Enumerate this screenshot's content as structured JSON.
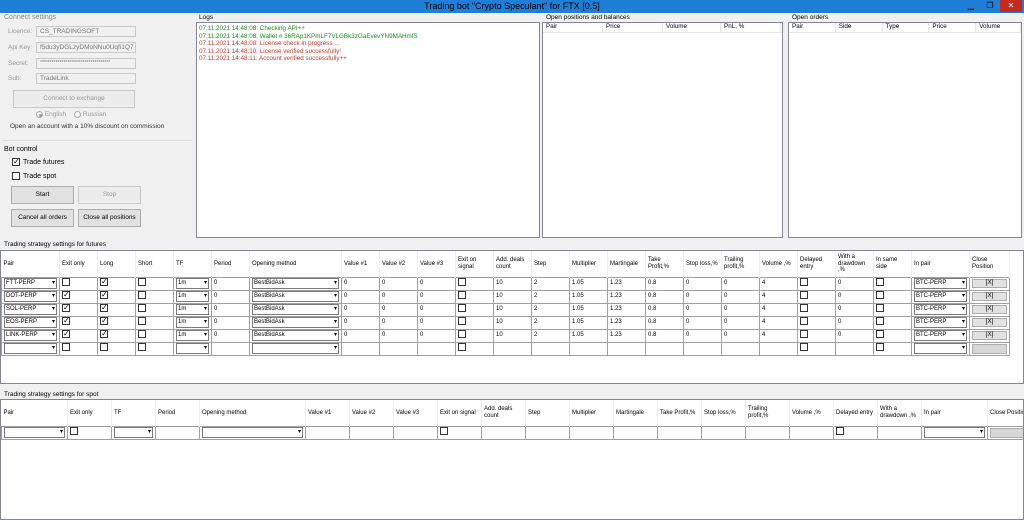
{
  "window": {
    "title": "Trading bot \"Crypto Speculant\" for FTX [0.5]",
    "minimize": "▁",
    "restore": "❐",
    "close": "✕"
  },
  "connect": {
    "group_title": "Connect settings",
    "licence_label": "Licence:",
    "licence_value": "CS_TRADINGSOFT",
    "apikey_label": "Api Key:",
    "apikey_value": "f5du3yDGLzyDMoNNu0Uqfi1Q7",
    "secret_label": "Secret:",
    "secret_value": "************************************",
    "sub_label": "Sub:",
    "sub_value": "TradeLink",
    "connect_button": "Connect to exchange",
    "lang_english": "English",
    "lang_russian": "Russian",
    "promo_text": "Open an account with a 10% discount on commission"
  },
  "bot_control": {
    "group_title": "Bot control",
    "trade_futures": "Trade futures",
    "trade_futures_checked": true,
    "trade_spot": "Trade spot",
    "trade_spot_checked": false,
    "start": "Start",
    "stop": "Stop",
    "cancel_all": "Cancel all orders",
    "close_all": "Close all positions"
  },
  "logs": {
    "title": "Logs",
    "lines": [
      {
        "text": "07.11.2021 14:48:08: Checking API++",
        "color": "#1a8a1a"
      },
      {
        "text": "07.11.2021 14:48:08: Wallet # 36RAp1KPmLF7VLGBk3zGaEvevYN9MAHmfS",
        "color": "#1a8a1a"
      },
      {
        "text": "07.11.2021 14:48:08: License check in progress ...",
        "color": "#c0392b"
      },
      {
        "text": "07.11.2021 14:48:10: License verified successfully!",
        "color": "#c0392b"
      },
      {
        "text": "07.11.2021 14:48:11: Account verified successfully++",
        "color": "#c0392b"
      }
    ]
  },
  "positions": {
    "title": "Open positions and balances",
    "columns": [
      "Pair",
      "Price",
      "Volume",
      "PnL, %"
    ]
  },
  "orders": {
    "title": "Open orders",
    "columns": [
      "Pair",
      "Side",
      "Type",
      "Price",
      "Volume"
    ]
  },
  "futures": {
    "title": "Trading strategy settings for futures",
    "columns": [
      "Pair",
      "Exit only",
      "Long",
      "Short",
      "TF",
      "Period",
      "Opening method",
      "Value #1",
      "Value #2",
      "Value #3",
      "Exit on signal",
      "Add. deals count",
      "Step",
      "Multiplier",
      "Martingale",
      "Take Profit,%",
      "Stop loss,%",
      "Trailing profit,%",
      "Volume ,%",
      "Delayed entry",
      "With a drawdown ,%",
      "In same side",
      "In pair",
      "Close Position"
    ],
    "rows": [
      {
        "pair": "FTT-PERP",
        "exit_only": false,
        "long": true,
        "short": false,
        "tf": "1m",
        "period": "0",
        "method": "BestBidAsk",
        "v1": "0",
        "v2": "0",
        "v3": "0",
        "exit_signal": false,
        "add_deals": "10",
        "step": "2",
        "mult": "1.05",
        "mart": "1.23",
        "tp": "0.8",
        "sl": "0",
        "trail": "0",
        "volume": "4",
        "delayed": false,
        "drawdown": "0",
        "same_side": false,
        "in_pair": "BTC-PERP",
        "close": "[X]"
      },
      {
        "pair": "DOT-PERP",
        "exit_only": true,
        "long": true,
        "short": false,
        "tf": "1m",
        "period": "0",
        "method": "BestBidAsk",
        "v1": "0",
        "v2": "0",
        "v3": "0",
        "exit_signal": false,
        "add_deals": "10",
        "step": "2",
        "mult": "1.05",
        "mart": "1.23",
        "tp": "0.8",
        "sl": "0",
        "trail": "0",
        "volume": "4",
        "delayed": false,
        "drawdown": "0",
        "same_side": false,
        "in_pair": "BTC-PERP",
        "close": "[X]"
      },
      {
        "pair": "SOL-PERP",
        "exit_only": true,
        "long": true,
        "short": false,
        "tf": "1m",
        "period": "0",
        "method": "BestBidAsk",
        "v1": "0",
        "v2": "0",
        "v3": "0",
        "exit_signal": false,
        "add_deals": "10",
        "step": "2",
        "mult": "1.05",
        "mart": "1.23",
        "tp": "0.8",
        "sl": "0",
        "trail": "0",
        "volume": "4",
        "delayed": false,
        "drawdown": "0",
        "same_side": false,
        "in_pair": "BTC-PERP",
        "close": "[X]"
      },
      {
        "pair": "EOS-PERP",
        "exit_only": true,
        "long": true,
        "short": false,
        "tf": "1m",
        "period": "0",
        "method": "BestBidAsk",
        "v1": "0",
        "v2": "0",
        "v3": "0",
        "exit_signal": false,
        "add_deals": "10",
        "step": "2",
        "mult": "1.05",
        "mart": "1.23",
        "tp": "0.8",
        "sl": "0",
        "trail": "0",
        "volume": "4",
        "delayed": false,
        "drawdown": "0",
        "same_side": false,
        "in_pair": "BTC-PERP",
        "close": "[X]"
      },
      {
        "pair": "LINK-PERP",
        "exit_only": true,
        "long": true,
        "short": false,
        "tf": "1m",
        "period": "0",
        "method": "BestBidAsk",
        "v1": "0",
        "v2": "0",
        "v3": "0",
        "exit_signal": false,
        "add_deals": "10",
        "step": "2",
        "mult": "1.05",
        "mart": "1.23",
        "tp": "0.8",
        "sl": "0",
        "trail": "0",
        "volume": "4",
        "delayed": false,
        "drawdown": "0",
        "same_side": false,
        "in_pair": "BTC-PERP",
        "close": "[X]"
      }
    ]
  },
  "spot": {
    "title": "Trading strategy settings for spot",
    "columns": [
      "Pair",
      "Exit only",
      "TF",
      "Period",
      "Opening method",
      "Value #1",
      "Value #2",
      "Value #3",
      "Exit on signal",
      "Add. deals count",
      "Step",
      "Multiplier",
      "Martingale",
      "Take Profit,%",
      "Stop loss,%",
      "Trailing profit,%",
      "Volume ,%",
      "Delayed entry",
      "With a drawdown ,%",
      "In pair",
      "Close Position"
    ]
  }
}
